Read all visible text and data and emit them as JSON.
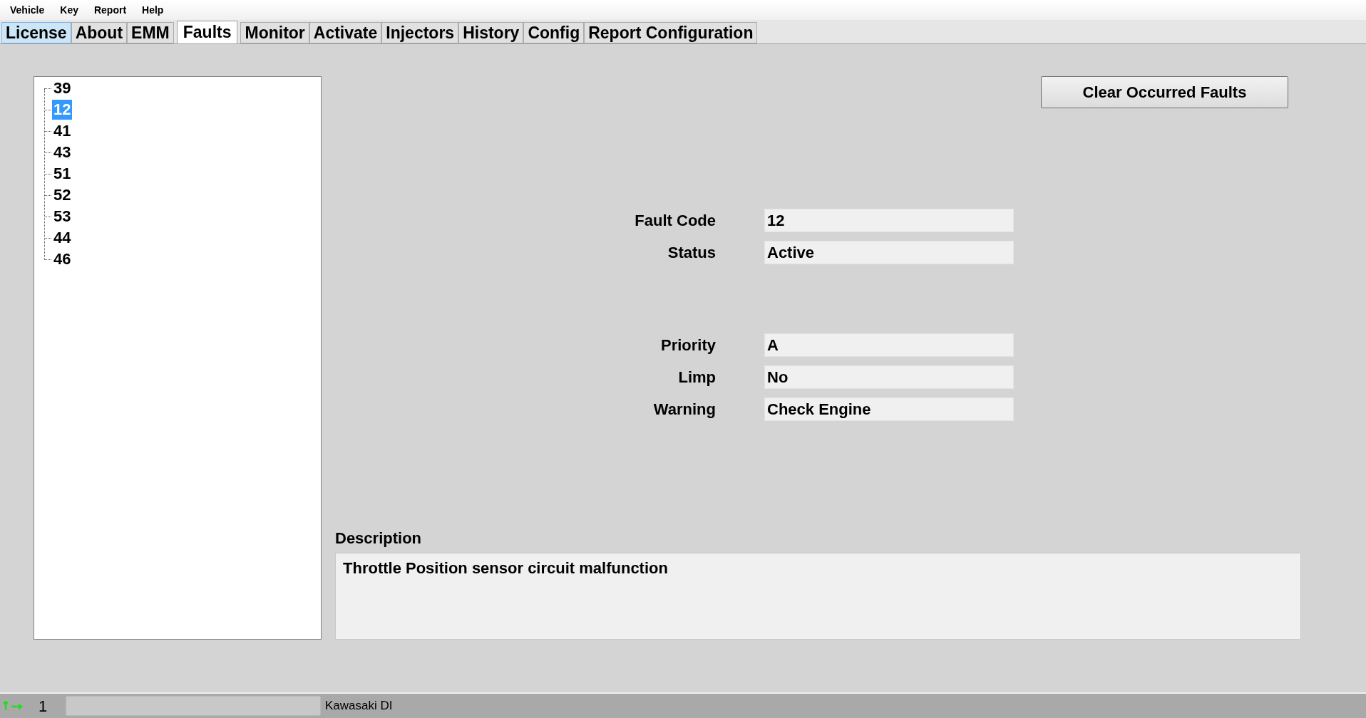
{
  "menu": [
    "Vehicle",
    "Key",
    "Report",
    "Help"
  ],
  "tabs": [
    {
      "label": "License",
      "selected": false,
      "hovered": true
    },
    {
      "label": "About",
      "selected": false,
      "hovered": false
    },
    {
      "label": "EMM",
      "selected": false,
      "hovered": false
    },
    {
      "label": "Faults",
      "selected": true,
      "hovered": false
    },
    {
      "label": "Monitor",
      "selected": false,
      "hovered": false
    },
    {
      "label": "Activate",
      "selected": false,
      "hovered": false
    },
    {
      "label": "Injectors",
      "selected": false,
      "hovered": false
    },
    {
      "label": "History",
      "selected": false,
      "hovered": false
    },
    {
      "label": "Config",
      "selected": false,
      "hovered": false
    },
    {
      "label": "Report Configuration",
      "selected": false,
      "hovered": false
    }
  ],
  "fault_tree": [
    {
      "label": "39",
      "selected": false
    },
    {
      "label": "12",
      "selected": true
    },
    {
      "label": "41",
      "selected": false
    },
    {
      "label": "43",
      "selected": false
    },
    {
      "label": "51",
      "selected": false
    },
    {
      "label": "52",
      "selected": false
    },
    {
      "label": "53",
      "selected": false
    },
    {
      "label": "44",
      "selected": false
    },
    {
      "label": "46",
      "selected": false
    }
  ],
  "clear_button": "Clear Occurred Faults",
  "field_groups": [
    [
      {
        "label": "Fault Code",
        "value": "12"
      },
      {
        "label": "Status",
        "value": "Active"
      }
    ],
    [
      {
        "label": "Priority",
        "value": "A"
      },
      {
        "label": "Limp",
        "value": "No"
      },
      {
        "label": "Warning",
        "value": "Check Engine"
      }
    ]
  ],
  "description": {
    "label": "Description",
    "value": "Throttle Position sensor circuit malfunction"
  },
  "status_bar": {
    "count": "1",
    "level": 0,
    "vehicle": "Kawasaki DI"
  }
}
